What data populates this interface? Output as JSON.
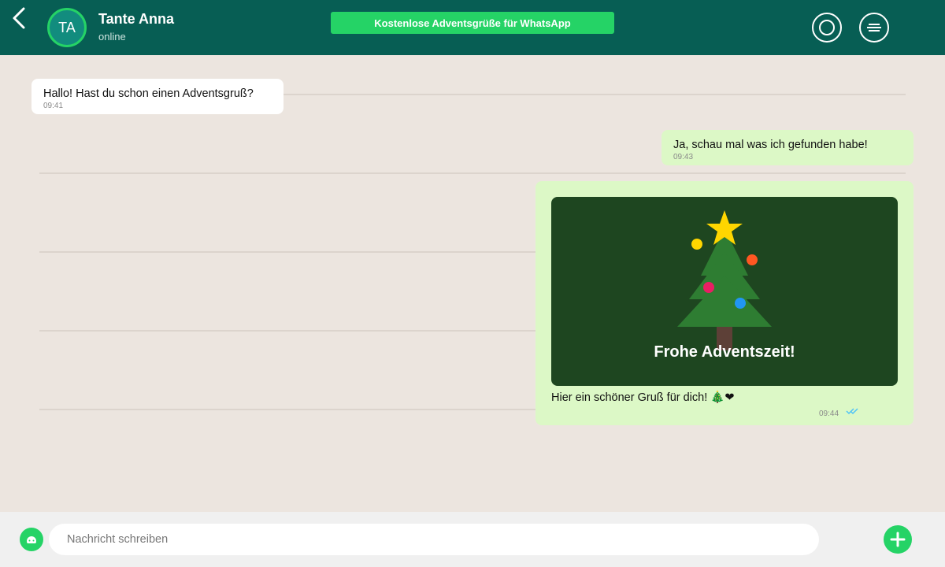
{
  "header": {
    "back_icon": "chevron-left-icon",
    "contact": {
      "initials": "TA",
      "name": "Tante Anna",
      "status": "online"
    },
    "promo": "Kostenlose Adventsgrüße für WhatsApp",
    "icons": [
      "camera-icon",
      "menu-icon"
    ]
  },
  "messages": [
    {
      "direction": "in",
      "text": "Hallo! Hast du schon einen Adventsgruß?",
      "time": "09:41"
    },
    {
      "direction": "out",
      "text": "Ja, schau mal was ich gefunden habe!",
      "time": "09:43"
    },
    {
      "direction": "out",
      "card_title": "Frohe Adventszeit!",
      "text": "Hier ein schöner Gruß für dich! 🎄❤",
      "time": "09:44",
      "status": "read"
    }
  ],
  "composer": {
    "placeholder": "Nachricht schreiben",
    "emoji_icon": "smiley-icon",
    "attach_icon": "plus-icon"
  },
  "colors": {
    "header": "#075e54",
    "accent": "#25d366",
    "outgoing_bubble": "#dcf8c6",
    "incoming_bubble": "#ffffff",
    "chat_background": "#ece5df",
    "card_background": "#1e4620"
  }
}
